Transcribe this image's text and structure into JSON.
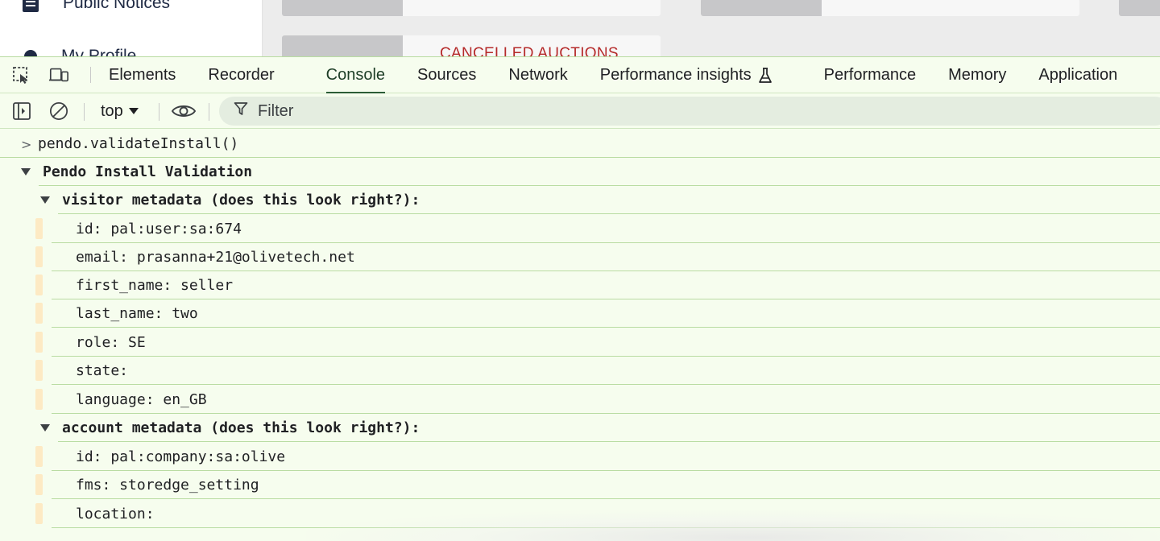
{
  "webpage": {
    "sidebar": {
      "items": [
        {
          "label": "Public Notices",
          "icon": "document-icon"
        },
        {
          "label": "My Profile",
          "icon": "user-icon"
        }
      ]
    },
    "cards": {
      "cancelled_label": "CANCELLED AUCTIONS"
    }
  },
  "devtools": {
    "tabs": [
      {
        "label": "Elements"
      },
      {
        "label": "Recorder"
      },
      {
        "label": "Console",
        "active": true
      },
      {
        "label": "Sources"
      },
      {
        "label": "Network"
      },
      {
        "label": "Performance insights",
        "icon": "flask-icon"
      },
      {
        "label": "Performance"
      },
      {
        "label": "Memory"
      },
      {
        "label": "Application"
      }
    ],
    "toolbar": {
      "context": "top",
      "filter_label": "Filter"
    },
    "console": {
      "command": "pendo.validateInstall()",
      "group_title": "Pendo Install Validation",
      "visitor_title": "visitor metadata (does this look right?):",
      "visitor": [
        "id: pal:user:sa:674",
        "email: prasanna+21@olivetech.net",
        "first_name: seller",
        "last_name: two",
        "role: SE",
        "state:",
        "language: en_GB"
      ],
      "account_title": "account metadata (does this look right?):",
      "account": [
        "id: pal:company:sa:olive",
        "fms: storedge_setting",
        "location:"
      ]
    }
  },
  "colors": {
    "devtools_bg": "#f6fdee",
    "row_separator": "#b9dca2",
    "active_tab_underline": "#2b5c36",
    "cancelled_text": "#b52a2a",
    "gutter": "#fdeac4"
  }
}
